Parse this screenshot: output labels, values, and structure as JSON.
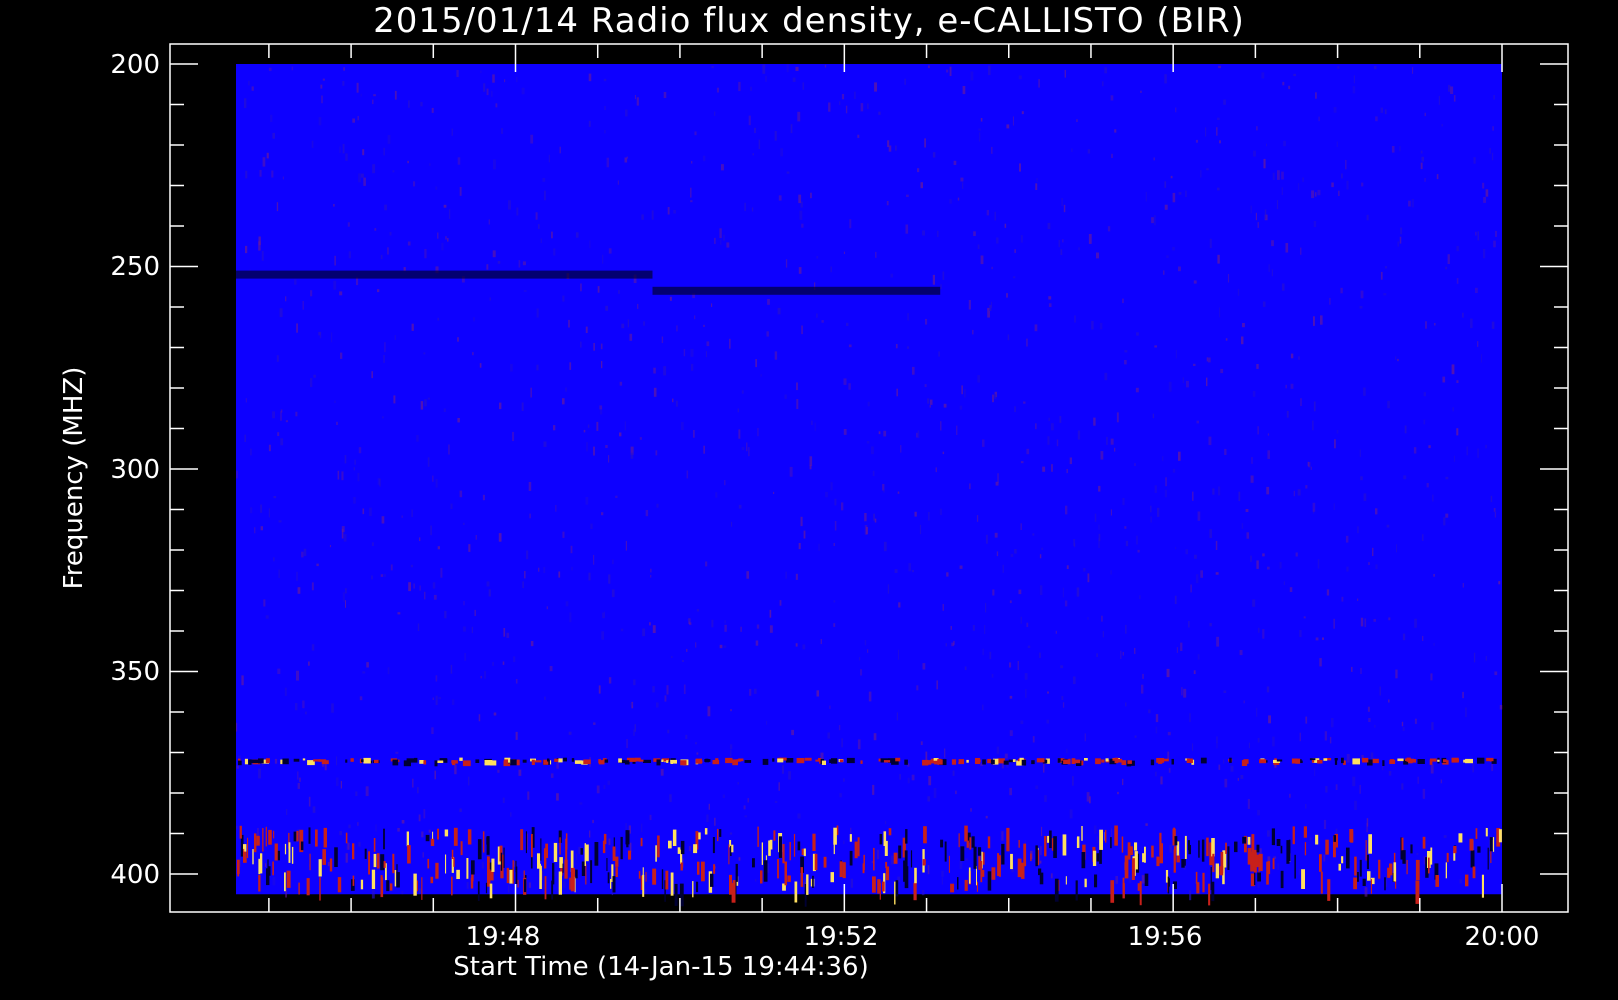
{
  "chart_data": {
    "type": "heatmap",
    "title": "2015/01/14  Radio flux density, e-CALLISTO (BIR)",
    "xlabel": "Start Time (14-Jan-15 19:44:36)",
    "ylabel": "Frequency (MHZ)",
    "x_ticks": [
      "19:48",
      "19:52",
      "19:56",
      "20:00"
    ],
    "y_ticks": [
      "200",
      "250",
      "300",
      "350",
      "400"
    ],
    "x_range": [
      "19:44:36",
      "20:00:00"
    ],
    "y_range": [
      200,
      405
    ],
    "y_inverted": true,
    "colormap": "blue-red-yellow",
    "colors": {
      "background": "#000000",
      "low": "#0d00ff",
      "mid": "#c8201a",
      "high": "#ffe060",
      "dark": "#000033"
    },
    "features": [
      {
        "label": "persistent interference band",
        "freq_mhz": 372
      },
      {
        "label": "strong interference band",
        "freq_range_mhz": [
          388,
          404
        ]
      },
      {
        "label": "dark band segment",
        "freq_mhz": 252,
        "time_range": [
          "19:44:36",
          "19:49:40"
        ]
      },
      {
        "label": "dark band segment",
        "freq_mhz": 256,
        "time_range": [
          "19:49:40",
          "19:53:10"
        ]
      }
    ]
  }
}
